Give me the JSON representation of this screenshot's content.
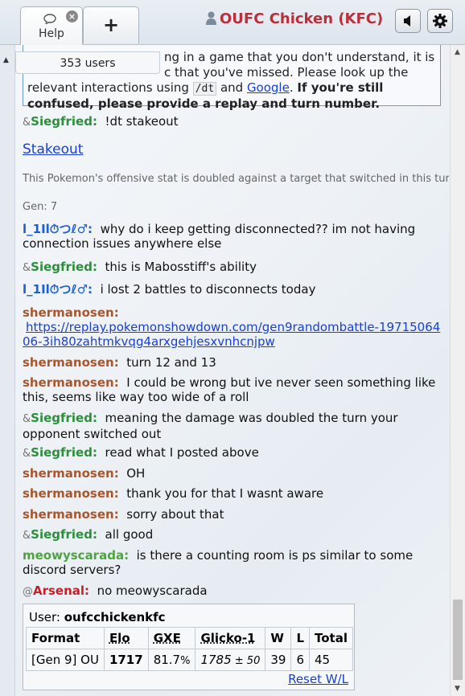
{
  "header": {
    "help_tab_label": "Help",
    "new_tab_label": "+",
    "username": "OUFC Chicken (KFC)"
  },
  "room": {
    "users_label": "353 users",
    "notice": {
      "line1": "ng in a game that you don't understand, it is",
      "line2": "c that you've missed. Please look up the",
      "line3a": "relevant interactions using ",
      "code": "/dt",
      "line3b": " and ",
      "google": "Google",
      "line3c": ". ",
      "bold1": "If you're still",
      "bold2": "confused, please provide a replay and turn number."
    }
  },
  "messages": [
    {
      "sym": "&",
      "user": "Siegfried:",
      "text": "!dt stakeout"
    },
    {
      "sym": "",
      "user": "l_1Il⏱つℓ♂:",
      "text": "why do i keep getting disconnected?? im not having connection issues anywhere else"
    },
    {
      "sym": "&",
      "user": "Siegfried:",
      "text": "this is Mabosstiff's ability"
    },
    {
      "sym": "",
      "user": "l_1Il⏱つℓ♂:",
      "text": "i lost 2 battles to disconnects today"
    },
    {
      "sym": "",
      "user": "shermanosen:",
      "text": "https://replay.pokemonshowdown.com/gen9randombattle-1971506406-3ih80zahtmkvqg4arxgehjesxvnhcnjpw"
    },
    {
      "sym": "",
      "user": "shermanosen:",
      "text": "turn 12 and 13"
    },
    {
      "sym": "",
      "user": "shermanosen:",
      "text": "I could be wrong but ive never seen something like this, seems like way too wide of a roll"
    },
    {
      "sym": "&",
      "user": "Siegfried:",
      "text": "meaning the damage was doubled the turn your opponent switched out"
    },
    {
      "sym": "&",
      "user": "Siegfried:",
      "text": "read what I posted above"
    },
    {
      "sym": "",
      "user": "shermanosen:",
      "text": "OH"
    },
    {
      "sym": "",
      "user": "shermanosen:",
      "text": "thank you for that I wasnt aware"
    },
    {
      "sym": "",
      "user": "shermanosen:",
      "text": "sorry about that"
    },
    {
      "sym": "&",
      "user": "Siegfried:",
      "text": "all good"
    },
    {
      "sym": "",
      "user": "meowyscarada:",
      "text": "is there a counting room is ps similar to some discord servers?"
    },
    {
      "sym": "@",
      "user": "Arsenal:",
      "text": "no meowyscarada"
    }
  ],
  "dt_result": {
    "link": "Stakeout",
    "desc": "This Pokemon's offensive stat is doubled against a target that switched in this turn.",
    "gen": "Gen: 7"
  },
  "stats": {
    "user_label": "User: ",
    "user_name": "oufcchickenkfc",
    "headers": [
      "Format",
      "Elo",
      "GXE",
      "Glicko-1",
      "W",
      "L",
      "Total"
    ],
    "row": {
      "format": "[Gen 9] OU",
      "elo": "1717",
      "gxe_main": "81.7",
      "gxe_pct": "%",
      "glicko_main": "1785",
      "glicko_dev": " ± 50",
      "w": "39",
      "l": "6",
      "total": "45"
    },
    "reset": "Reset W/L"
  }
}
